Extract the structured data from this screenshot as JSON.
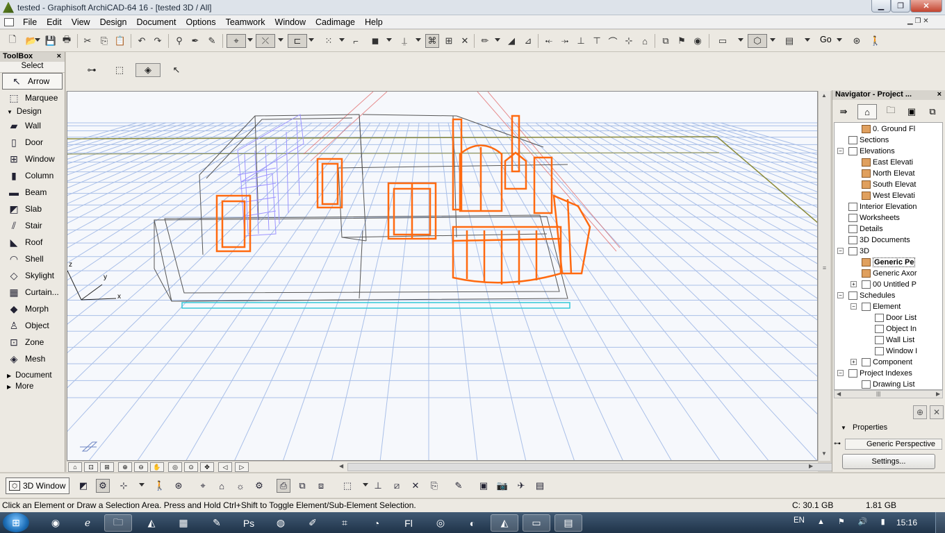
{
  "window": {
    "title": "tested - Graphisoft ArchiCAD-64 16 - [tested 3D / All]",
    "controls": {
      "minimize": "▁",
      "maximize": "❐",
      "close": "✕"
    },
    "doc_controls": "▁  ❐  ✕"
  },
  "menu": [
    "File",
    "Edit",
    "View",
    "Design",
    "Document",
    "Options",
    "Teamwork",
    "Window",
    "Cadimage",
    "Help"
  ],
  "toolbar": {
    "go_label": "Go"
  },
  "toolbox": {
    "title": "ToolBox",
    "close": "×",
    "select_label": "Select",
    "select_tools": [
      {
        "label": "Arrow",
        "icon": "arrow-icon",
        "glyph": "↖"
      },
      {
        "label": "Marquee",
        "icon": "marquee-icon",
        "glyph": "⬚"
      }
    ],
    "design_header": "Design",
    "design_tools": [
      {
        "label": "Wall",
        "icon": "wall-icon",
        "glyph": "▰"
      },
      {
        "label": "Door",
        "icon": "door-icon",
        "glyph": "▯"
      },
      {
        "label": "Window",
        "icon": "window-icon",
        "glyph": "⊞"
      },
      {
        "label": "Column",
        "icon": "column-icon",
        "glyph": "▮"
      },
      {
        "label": "Beam",
        "icon": "beam-icon",
        "glyph": "▬"
      },
      {
        "label": "Slab",
        "icon": "slab-icon",
        "glyph": "◩"
      },
      {
        "label": "Stair",
        "icon": "stair-icon",
        "glyph": "⫽"
      },
      {
        "label": "Roof",
        "icon": "roof-icon",
        "glyph": "◣"
      },
      {
        "label": "Shell",
        "icon": "shell-icon",
        "glyph": "◠"
      },
      {
        "label": "Skylight",
        "icon": "skylight-icon",
        "glyph": "◇"
      },
      {
        "label": "Curtain...",
        "icon": "curtain-wall-icon",
        "glyph": "▦"
      },
      {
        "label": "Morph",
        "icon": "morph-icon",
        "glyph": "◆"
      },
      {
        "label": "Object",
        "icon": "object-icon",
        "glyph": "♙"
      },
      {
        "label": "Zone",
        "icon": "zone-icon",
        "glyph": "⊡"
      },
      {
        "label": "Mesh",
        "icon": "mesh-icon",
        "glyph": "◈"
      }
    ],
    "document_header": "Document",
    "more_header": "More"
  },
  "navigator": {
    "title": "Navigator - Project ...",
    "close": "×",
    "tree": [
      {
        "label": "0. Ground Fl",
        "indent": 3,
        "icon": "elev"
      },
      {
        "label": "Sections",
        "indent": 2,
        "icon": "plain"
      },
      {
        "label": "Elevations",
        "indent": 2,
        "icon": "plain",
        "expander": "−"
      },
      {
        "label": "East Elevati",
        "indent": 3,
        "icon": "elev"
      },
      {
        "label": "North Elevat",
        "indent": 3,
        "icon": "elev"
      },
      {
        "label": "South Elevat",
        "indent": 3,
        "icon": "elev"
      },
      {
        "label": "West Elevati",
        "indent": 3,
        "icon": "elev"
      },
      {
        "label": "Interior Elevation",
        "indent": 2,
        "icon": "plain"
      },
      {
        "label": "Worksheets",
        "indent": 2,
        "icon": "plain"
      },
      {
        "label": "Details",
        "indent": 2,
        "icon": "plain"
      },
      {
        "label": "3D Documents",
        "indent": 2,
        "icon": "plain"
      },
      {
        "label": "3D",
        "indent": 2,
        "icon": "plain",
        "expander": "−"
      },
      {
        "label": "Generic Pe",
        "indent": 3,
        "icon": "elev",
        "selected": true
      },
      {
        "label": "Generic Axor",
        "indent": 3,
        "icon": "elev"
      },
      {
        "label": "00 Untitled P",
        "indent": 3,
        "icon": "plain",
        "expander": "+"
      },
      {
        "label": "Schedules",
        "indent": 2,
        "icon": "plain",
        "expander": "−"
      },
      {
        "label": "Element",
        "indent": 3,
        "icon": "plain",
        "expander": "−"
      },
      {
        "label": "Door List",
        "indent": 4,
        "icon": "plain"
      },
      {
        "label": "Object In",
        "indent": 4,
        "icon": "plain"
      },
      {
        "label": "Wall List",
        "indent": 4,
        "icon": "plain"
      },
      {
        "label": "Window I",
        "indent": 4,
        "icon": "plain"
      },
      {
        "label": "Component",
        "indent": 3,
        "icon": "plain",
        "expander": "+"
      },
      {
        "label": "Project Indexes",
        "indent": 2,
        "icon": "plain",
        "expander": "−"
      },
      {
        "label": "Drawing List",
        "indent": 3,
        "icon": "plain"
      }
    ],
    "properties_label": "Properties",
    "properties_value": "Generic Perspective",
    "settings_button": "Settings..."
  },
  "bottom_toolbar": {
    "window_button": "3D Window"
  },
  "status": {
    "hint": "Click an Element or Draw a Selection Area. Press and Hold Ctrl+Shift to Toggle Element/Sub-Element Selection.",
    "disk": "C: 30.1 GB",
    "memory": "1.81 GB"
  },
  "viewport": {
    "axes": {
      "x": "x",
      "y": "y",
      "z": "z"
    }
  },
  "taskbar": {
    "language": "EN",
    "clock": "15:16"
  },
  "colors": {
    "selection_orange": "#ff6a10",
    "railing_violet": "#9b93ff",
    "grid_blue": "#a9bfe8",
    "slab_cyan": "#33c8d8",
    "outline_olive": "#8a8a3a"
  }
}
